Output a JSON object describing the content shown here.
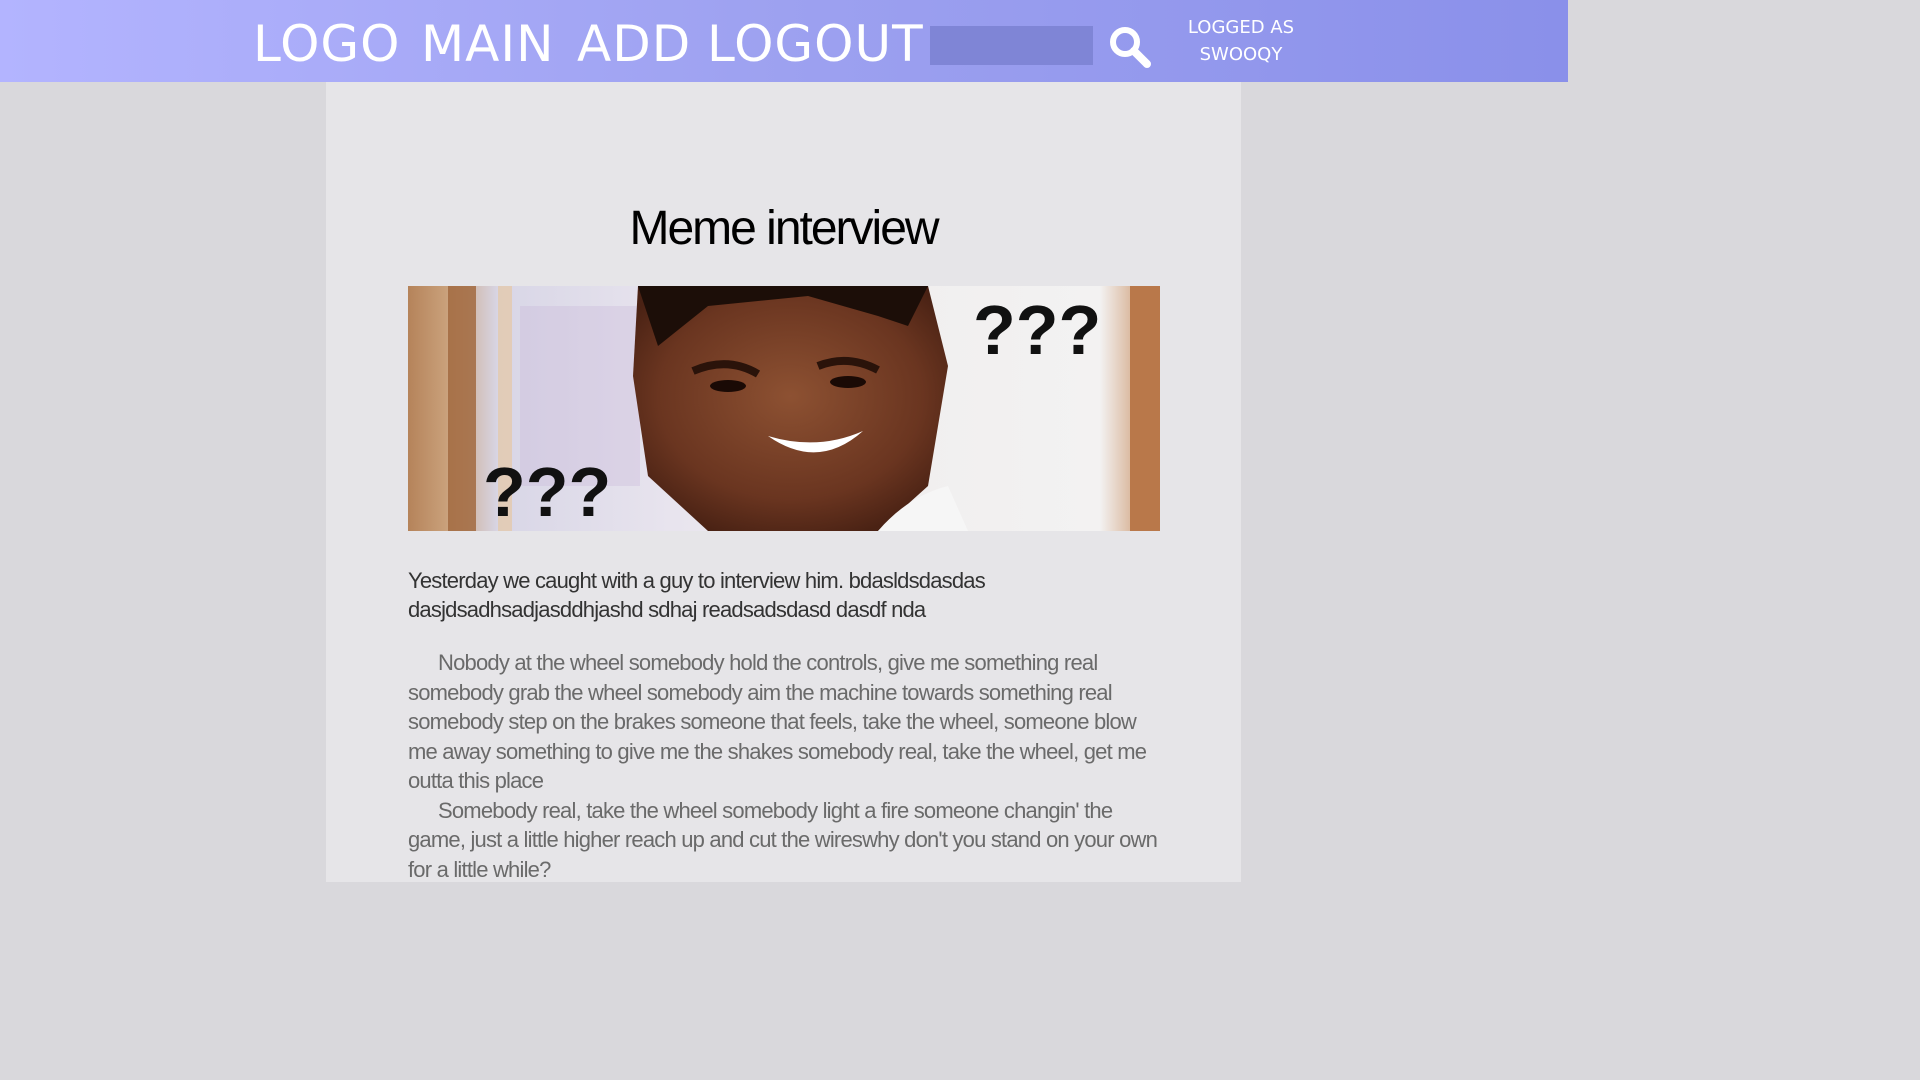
{
  "nav": {
    "logo": "LOGO",
    "main": "MAIN",
    "add": "ADD",
    "logout": "LOGOUT"
  },
  "search": {
    "value": "",
    "icon": "search-icon"
  },
  "user": {
    "line1": "LOGGED AS",
    "line2": "SWOOQY"
  },
  "article": {
    "title": "Meme interview",
    "image_text_top": "???",
    "image_text_bottom": "???",
    "lead": "Yesterday we caught with a guy to interview him. bdasldsdasdas dasjdsadhsadjasddhjashd sdhaj readsadsdasd dasdf nda",
    "paragraphs": [
      "Nobody at the wheel somebody hold the controls, give me something real somebody grab the wheel somebody aim the machine towards something real somebody step on the brakes someone that feels, take the wheel, someone blow me away something to give me the shakes somebody real, take the wheel, get me outta this place",
      "Somebody real, take the wheel somebody light a fire someone changin' the game, just a little higher reach up and cut the wireswhy don't you stand on your own for a little while?"
    ]
  },
  "colors": {
    "header_gradient_start": "#b3b4ff",
    "header_gradient_end": "#8a90ea",
    "search_field": "#7f85d6",
    "content_bg": "#e6e5e8",
    "page_bg": "#d9d8dc"
  }
}
